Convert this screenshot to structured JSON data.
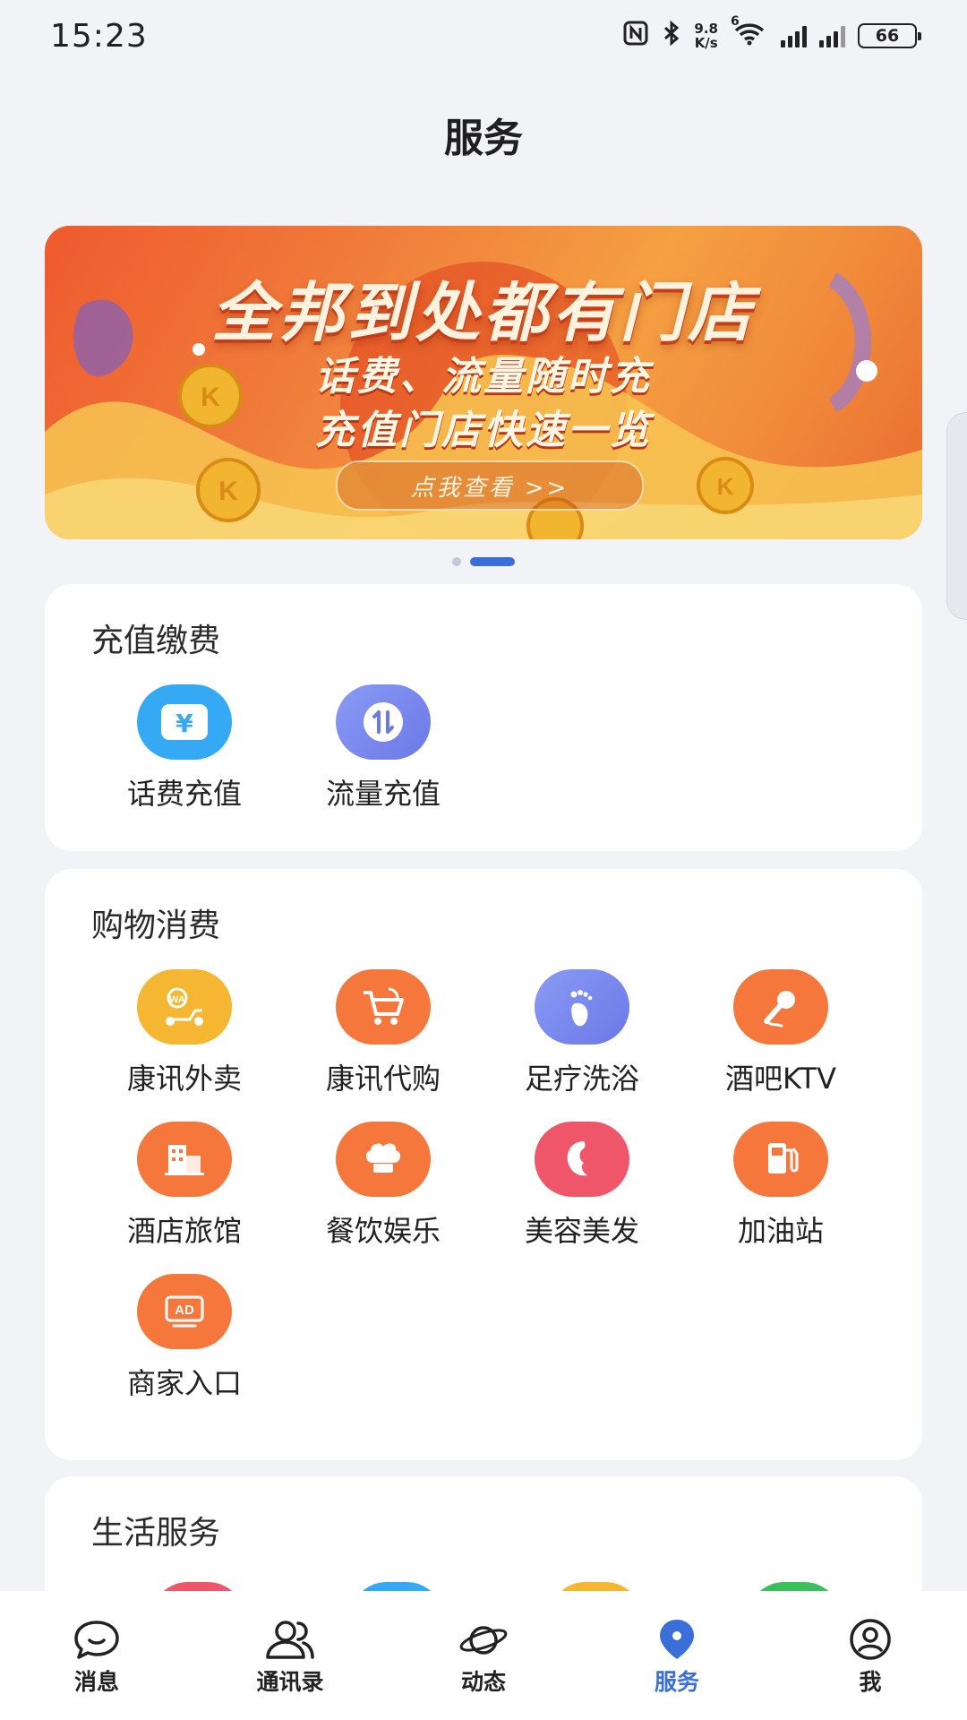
{
  "status_bar": {
    "time": "15:23",
    "net_speed_value": "9.8",
    "net_speed_unit": "K/s",
    "wifi_badge": "6",
    "battery": "66"
  },
  "header": {
    "title": "服务"
  },
  "banner": {
    "line1": "全邦到处都有门店",
    "line2": "话费、流量随时充",
    "line3": "充值门店快速一览",
    "cta": "点我查看 >>",
    "active_index": 1,
    "count": 2
  },
  "sections": [
    {
      "title": "充值缴费",
      "items": [
        {
          "label": "话费充值",
          "icon": "yuan-icon",
          "color": "#36a9f4"
        },
        {
          "label": "流量充值",
          "icon": "data-transfer-icon",
          "color": "#7b8cf0"
        }
      ]
    },
    {
      "title": "购物消费",
      "items": [
        {
          "label": "康讯外卖",
          "icon": "delivery-scooter-icon",
          "color": "#f5b731"
        },
        {
          "label": "康讯代购",
          "icon": "shopping-cart-icon",
          "color": "#f5773c"
        },
        {
          "label": "足疗洗浴",
          "icon": "footprint-icon",
          "color": "#7b8cf0"
        },
        {
          "label": "酒吧KTV",
          "icon": "microphone-icon",
          "color": "#f5773c"
        },
        {
          "label": "酒店旅馆",
          "icon": "hotel-building-icon",
          "color": "#f5773c"
        },
        {
          "label": "餐饮娱乐",
          "icon": "chef-hat-icon",
          "color": "#f5773c"
        },
        {
          "label": "美容美发",
          "icon": "face-beauty-icon",
          "color": "#f0566a"
        },
        {
          "label": "加油站",
          "icon": "fuel-pump-icon",
          "color": "#f5773c"
        },
        {
          "label": "商家入口",
          "icon": "ad-screen-icon",
          "color": "#f5773c"
        }
      ]
    },
    {
      "title": "生活服务",
      "items": []
    }
  ],
  "nav": [
    {
      "label": "消息",
      "icon": "chat-bubble-icon"
    },
    {
      "label": "通讯录",
      "icon": "contacts-icon"
    },
    {
      "label": "动态",
      "icon": "planet-icon"
    },
    {
      "label": "服务",
      "icon": "location-pin-icon",
      "active": true
    },
    {
      "label": "我",
      "icon": "user-circle-icon"
    }
  ],
  "colors": {
    "accent": "#3a6fd9",
    "background": "#f1f3f7",
    "card": "#ffffff"
  }
}
